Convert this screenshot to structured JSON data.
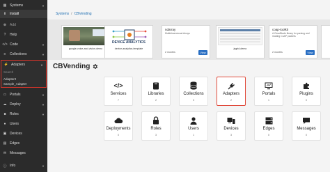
{
  "sidebar": {
    "items": [
      {
        "label": "Systems",
        "icon": "grid-icon",
        "caret": true
      },
      {
        "label": "Install",
        "icon": "download-icon",
        "caret": false
      },
      {
        "label": "Add",
        "icon": "plus-circle-icon",
        "caret": false
      },
      {
        "label": "Help",
        "icon": "help-icon",
        "caret": false
      },
      {
        "label": "Code",
        "icon": "code-icon",
        "caret": true
      },
      {
        "label": "Collections",
        "icon": "database-icon",
        "caret": true
      },
      {
        "label": "Adapters",
        "icon": "plug-icon",
        "caret": true
      },
      {
        "label": "Portals",
        "icon": "monitor-icon",
        "caret": true
      },
      {
        "label": "Deploy",
        "icon": "cloud-icon",
        "caret": true
      },
      {
        "label": "Roles",
        "icon": "lock-icon",
        "caret": true
      },
      {
        "label": "Users",
        "icon": "user-icon",
        "caret": false
      },
      {
        "label": "Devices",
        "icon": "devices-icon",
        "caret": false
      },
      {
        "label": "Edges",
        "icon": "edges-icon",
        "caret": false
      },
      {
        "label": "Messages",
        "icon": "message-icon",
        "caret": false
      },
      {
        "label": "Info",
        "icon": "info-icon",
        "caret": true
      }
    ],
    "adapters_panel": {
      "search": "Search",
      "subitems": [
        "Adapter2",
        "Sample_Adapter"
      ]
    }
  },
  "breadcrumb": {
    "root": "Systems",
    "separator": "/",
    "current": "CBVending"
  },
  "ipm_cards": [
    {
      "caption": "google-voice-and-vision-demo",
      "kind": "thumb"
    },
    {
      "caption": "device-analytics-template",
      "kind": "analytics",
      "thumb_text": "DEVICE ANALYTICS"
    },
    {
      "title": "ndarray",
      "desc": "Multidimensional Arrays",
      "age": "2 months",
      "view": "View",
      "kind": "info"
    },
    {
      "caption": "jsgrid-demo",
      "kind": "thumb"
    },
    {
      "title": "coap-toolkit",
      "desc": "A ClearBlade library for parsing and reading CoAP packets",
      "age": "2 months",
      "view": "View",
      "kind": "info"
    }
  ],
  "page_title": "CBVending",
  "tiles": [
    {
      "label": "Services",
      "count": "7",
      "icon": "code-icon"
    },
    {
      "label": "Libraries",
      "count": "2",
      "icon": "book-icon"
    },
    {
      "label": "Collections",
      "count": "3",
      "icon": "database-icon"
    },
    {
      "label": "Adapters",
      "count": "2",
      "icon": "plug-icon",
      "selected": true
    },
    {
      "label": "Portals",
      "count": "1",
      "icon": "monitor-icon"
    },
    {
      "label": "Plugins",
      "count": "0",
      "icon": "puzzle-icon"
    },
    {
      "label": "Deployments",
      "count": "0",
      "icon": "cloud-icon"
    },
    {
      "label": "Roles",
      "count": "3",
      "icon": "lock-icon"
    },
    {
      "label": "Users",
      "count": "1",
      "icon": "user-icon"
    },
    {
      "label": "Devices",
      "count": "3",
      "icon": "devices-icon"
    },
    {
      "label": "Edges",
      "count": "0",
      "icon": "edges-icon"
    },
    {
      "label": "Messages",
      "count": "0",
      "icon": "message-icon"
    }
  ]
}
